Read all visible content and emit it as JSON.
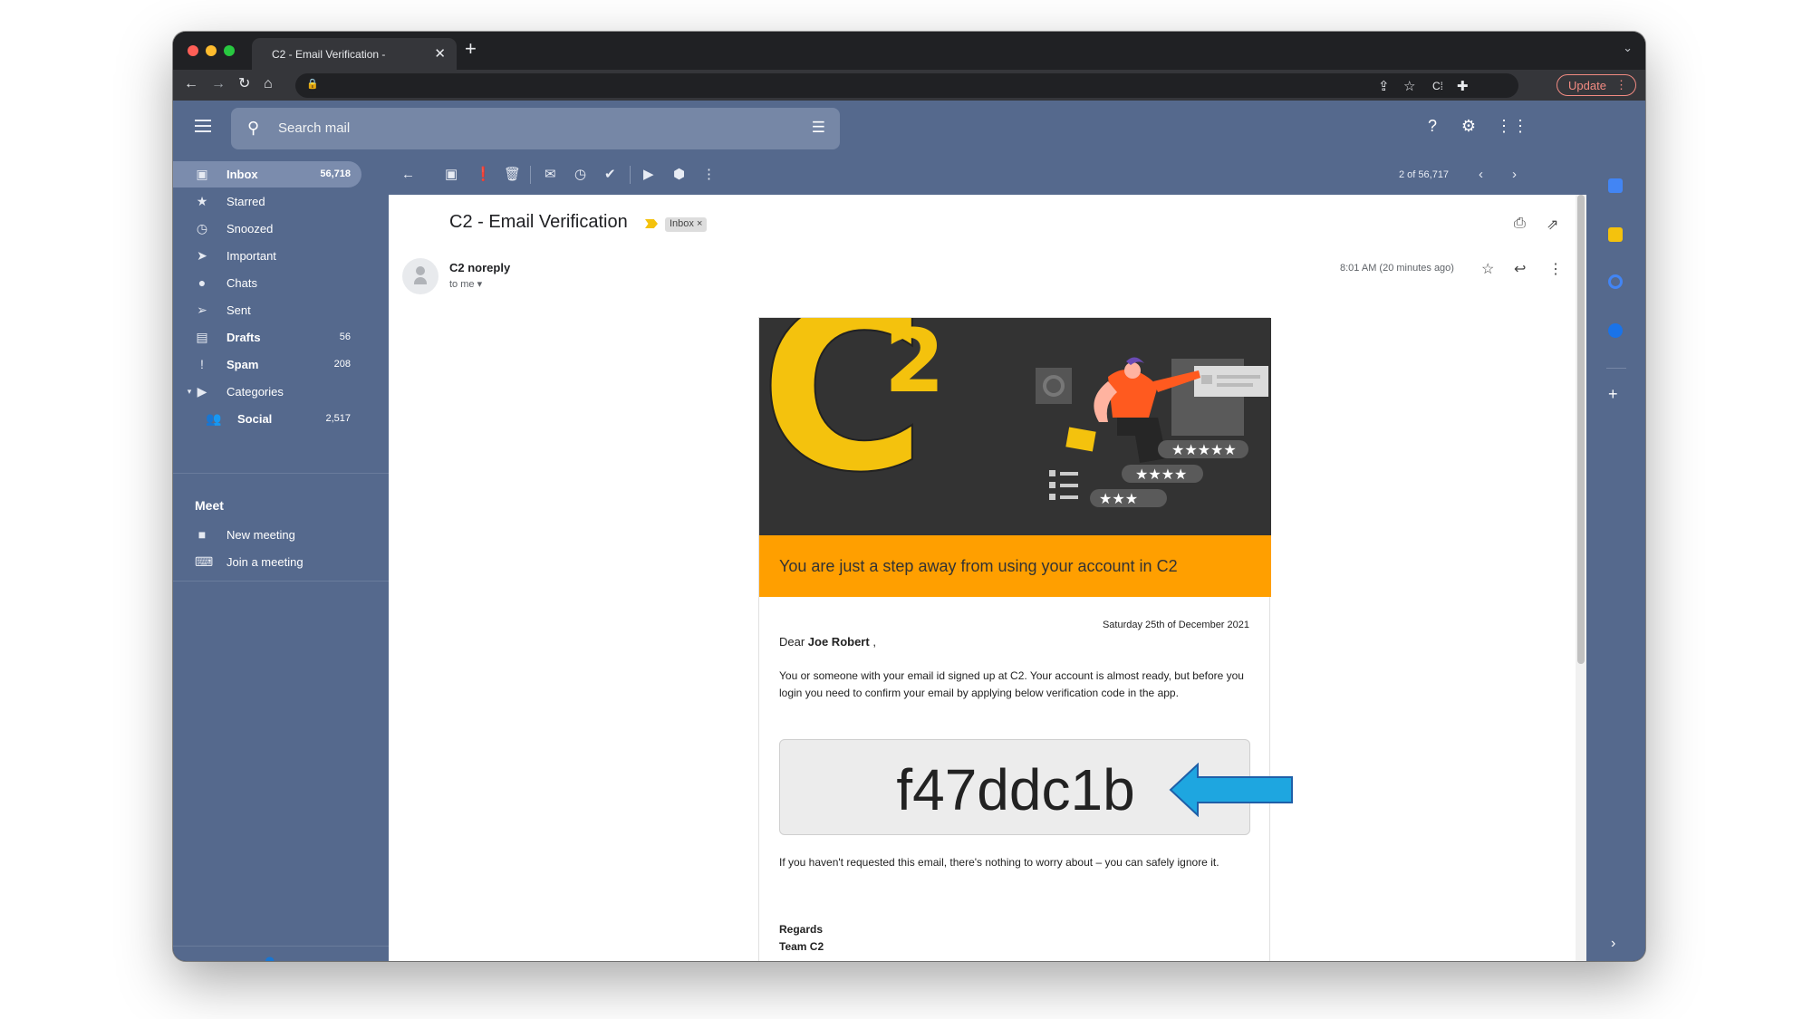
{
  "browser": {
    "tab_title": "C2 - Email Verification -",
    "tab_close": "✕",
    "new_tab": "+",
    "update_label": "Update"
  },
  "gmail": {
    "search_placeholder": "Search mail",
    "sidebar": {
      "items": [
        {
          "label": "Inbox",
          "count": "56,718",
          "icon": "inbox-icon"
        },
        {
          "label": "Starred",
          "count": "",
          "icon": "star-icon"
        },
        {
          "label": "Snoozed",
          "count": "",
          "icon": "clock-icon"
        },
        {
          "label": "Important",
          "count": "",
          "icon": "important-icon"
        },
        {
          "label": "Chats",
          "count": "",
          "icon": "chat-icon"
        },
        {
          "label": "Sent",
          "count": "",
          "icon": "send-icon"
        },
        {
          "label": "Drafts",
          "count": "56",
          "icon": "draft-icon"
        },
        {
          "label": "Spam",
          "count": "208",
          "icon": "spam-icon"
        },
        {
          "label": "Categories",
          "count": "",
          "icon": "label-icon"
        },
        {
          "label": "Social",
          "count": "2,517",
          "icon": "people-icon"
        }
      ],
      "meet_heading": "Meet",
      "meet_items": [
        {
          "label": "New meeting",
          "icon": "video-icon"
        },
        {
          "label": "Join a meeting",
          "icon": "keyboard-icon"
        }
      ]
    },
    "pager": "2 of 56,717",
    "message": {
      "subject": "C2 - Email Verification",
      "label_chip": "Inbox ×",
      "sender": "C2 noreply",
      "to": "to me ▾",
      "timestamp": "8:01 AM (20 minutes ago)"
    },
    "email_body": {
      "logo_letter": "C",
      "logo_super": "2",
      "banner": "You are just a step away from using your account in C2",
      "date": "Saturday 25th of December 2021",
      "dear_prefix": "Dear ",
      "dear_name": "Joe Robert",
      "dear_suffix": " ,",
      "paragraph": "You or someone with your email id signed up at C2. Your account is almost ready, but before you login you need to confirm your email by applying below verification code in the app.",
      "code": "f47ddc1b",
      "paragraph2": "If you haven't requested this email, there's nothing to worry about – you can safely ignore it.",
      "regards": "Regards",
      "team": "Team C2"
    },
    "colors": {
      "gmail_bg": "#55698d",
      "banner": "#ff9f00",
      "logo": "#f4c20d",
      "arrow": "#1ea6e0"
    }
  }
}
